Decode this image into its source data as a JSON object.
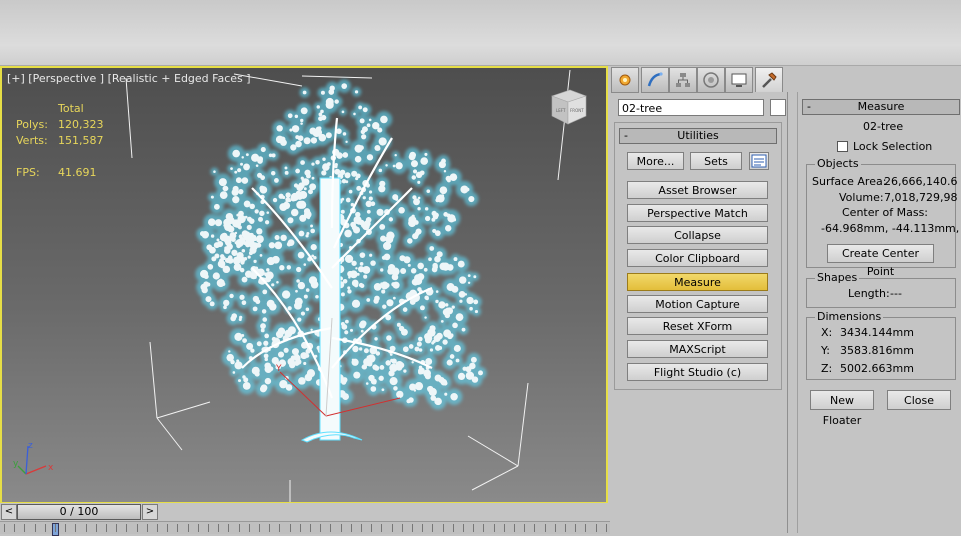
{
  "viewport": {
    "label": "[+] [Perspective ] [Realistic + Edged Faces ]",
    "stats": {
      "header": "Total",
      "polys_label": "Polys:",
      "polys_value": "120,323",
      "verts_label": "Verts:",
      "verts_value": "151,587",
      "fps_label": "FPS:",
      "fps_value": "41.691"
    },
    "viewcube": {
      "left": "LEFT",
      "front": "FRONT"
    },
    "axis": {
      "x": "x",
      "y": "y",
      "z": "z"
    }
  },
  "timeline": {
    "prev": "<",
    "next": ">",
    "frame_readout": "0 / 100",
    "current_frame": 0,
    "total_frames": 100
  },
  "command_panel": {
    "tabs": [
      "create-icon",
      "modify-icon",
      "hierarchy-icon",
      "motion-icon",
      "display-icon",
      "utilities-icon"
    ],
    "active_tab": "utilities-icon",
    "object_name": "02-tree",
    "utilities": {
      "title": "Utilities",
      "collapse": "-",
      "more_label": "More...",
      "sets_label": "Sets",
      "buttons": [
        "Asset Browser",
        "Perspective Match",
        "Collapse",
        "Color Clipboard",
        "Measure",
        "Motion Capture",
        "Reset XForm",
        "MAXScript",
        "Flight Studio (c)"
      ],
      "active_button": "Measure"
    },
    "measure": {
      "title": "Measure",
      "collapse": "-",
      "object_name": "02-tree",
      "lock_selection_label": "Lock Selection",
      "objects_group": "Objects",
      "surface_area_label": "Surface Area:",
      "surface_area_value": "26,666,140.6",
      "volume_label": "Volume:",
      "volume_value": "7,018,729,98",
      "center_of_mass_label": "Center of Mass:",
      "center_of_mass_value": "-64.968mm, -44.113mm,",
      "create_center_point": "Create Center Point",
      "shapes_group": "Shapes",
      "length_label": "Length:",
      "length_value": "---",
      "dimensions_group": "Dimensions",
      "x_label": "X:",
      "x_value": "3434.144mm",
      "y_label": "Y:",
      "y_value": "3583.816mm",
      "z_label": "Z:",
      "z_value": "5002.663mm",
      "new_floater": "New Floater",
      "close": "Close"
    }
  },
  "colors": {
    "viewport_border": "#e6de46",
    "stats_text": "#e7d65b",
    "active_button": "#e8c84a",
    "tree_wire": "#ffffff",
    "tree_glow": "#5fe0ff"
  }
}
